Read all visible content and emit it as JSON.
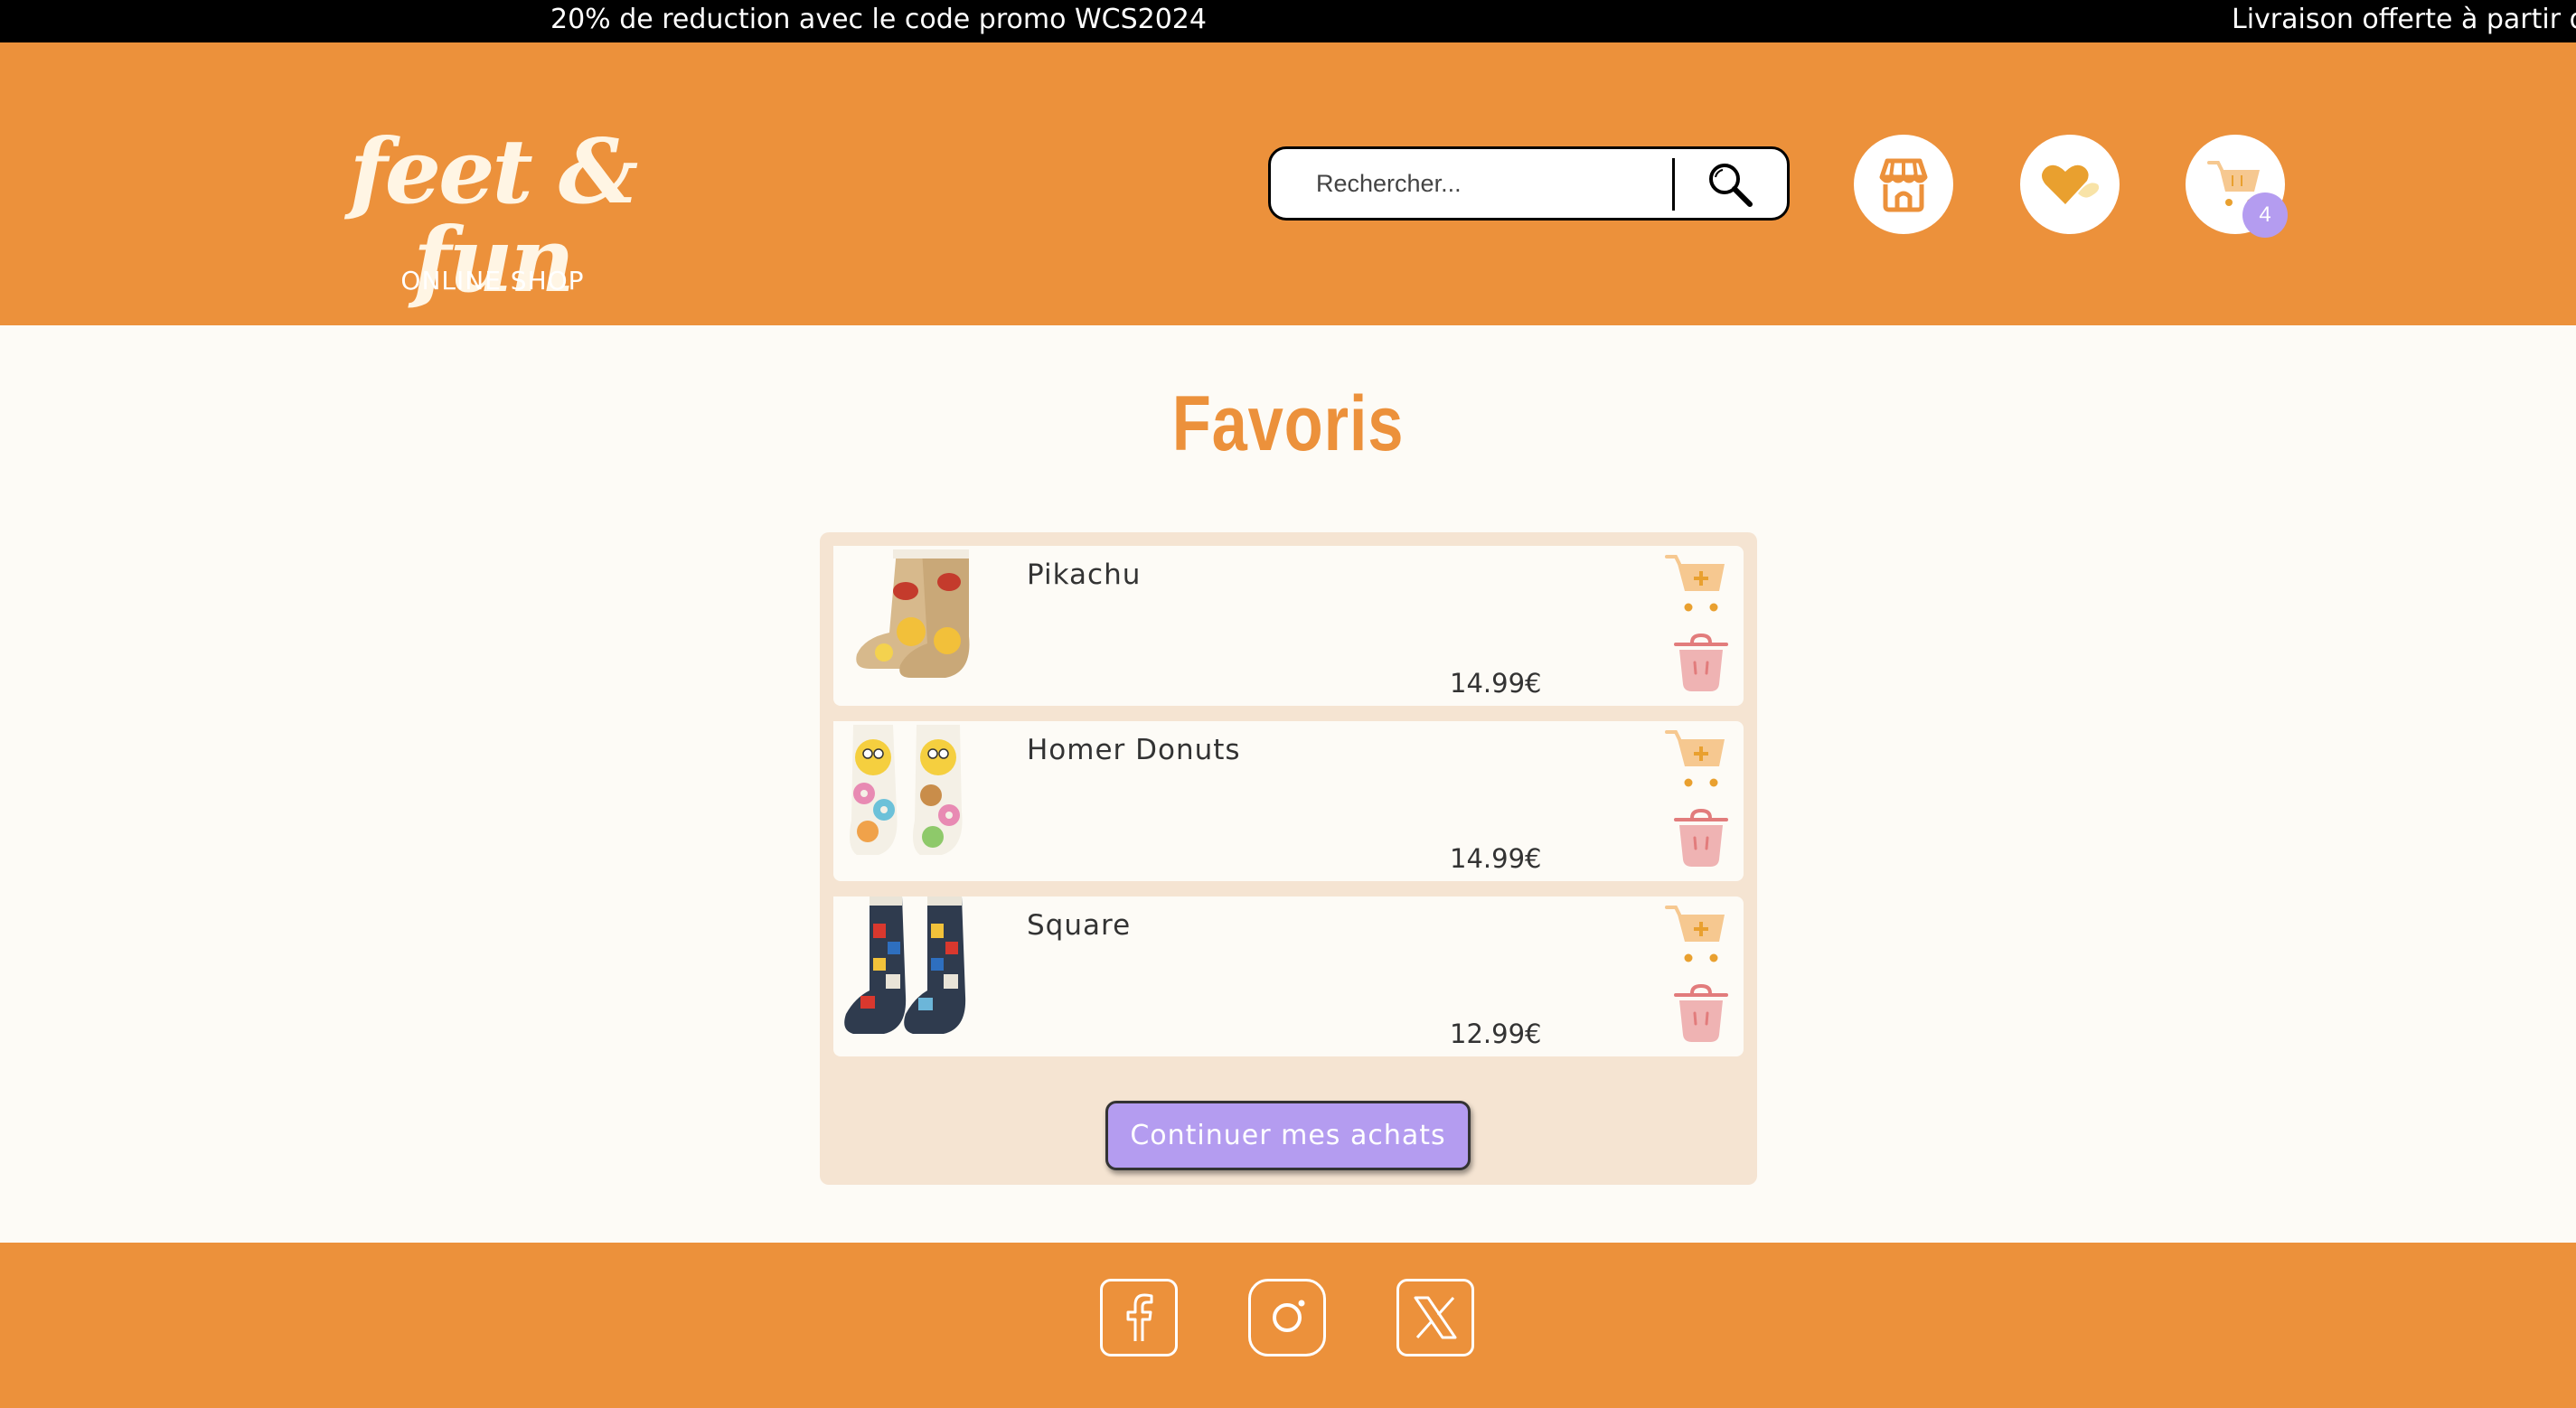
{
  "promo": {
    "message1": "20% de reduction avec le code promo WCS2024",
    "message2": "Livraison offerte à partir de"
  },
  "header": {
    "logo_title": "feet & fun",
    "logo_subtitle": "ONLINE SHOP",
    "search_placeholder": "Rechercher...",
    "cart_count": "4",
    "icons": [
      "search-icon",
      "shop-icon",
      "heart-icon",
      "cart-icon"
    ]
  },
  "main": {
    "title": "Favoris",
    "items": [
      {
        "name": "Pikachu",
        "price": "14.99€"
      },
      {
        "name": "Homer Donuts",
        "price": "14.99€"
      },
      {
        "name": "Square",
        "price": "12.99€"
      }
    ],
    "continue_label": "Continuer mes achats"
  },
  "footer": {
    "socials": [
      "facebook-icon",
      "instagram-icon",
      "x-icon"
    ]
  },
  "colors": {
    "primary": "#ec913b",
    "background": "#fdfbf6",
    "panel": "#f5e4d2",
    "accent": "#b49cf0",
    "trash": "#e9a0a0"
  }
}
